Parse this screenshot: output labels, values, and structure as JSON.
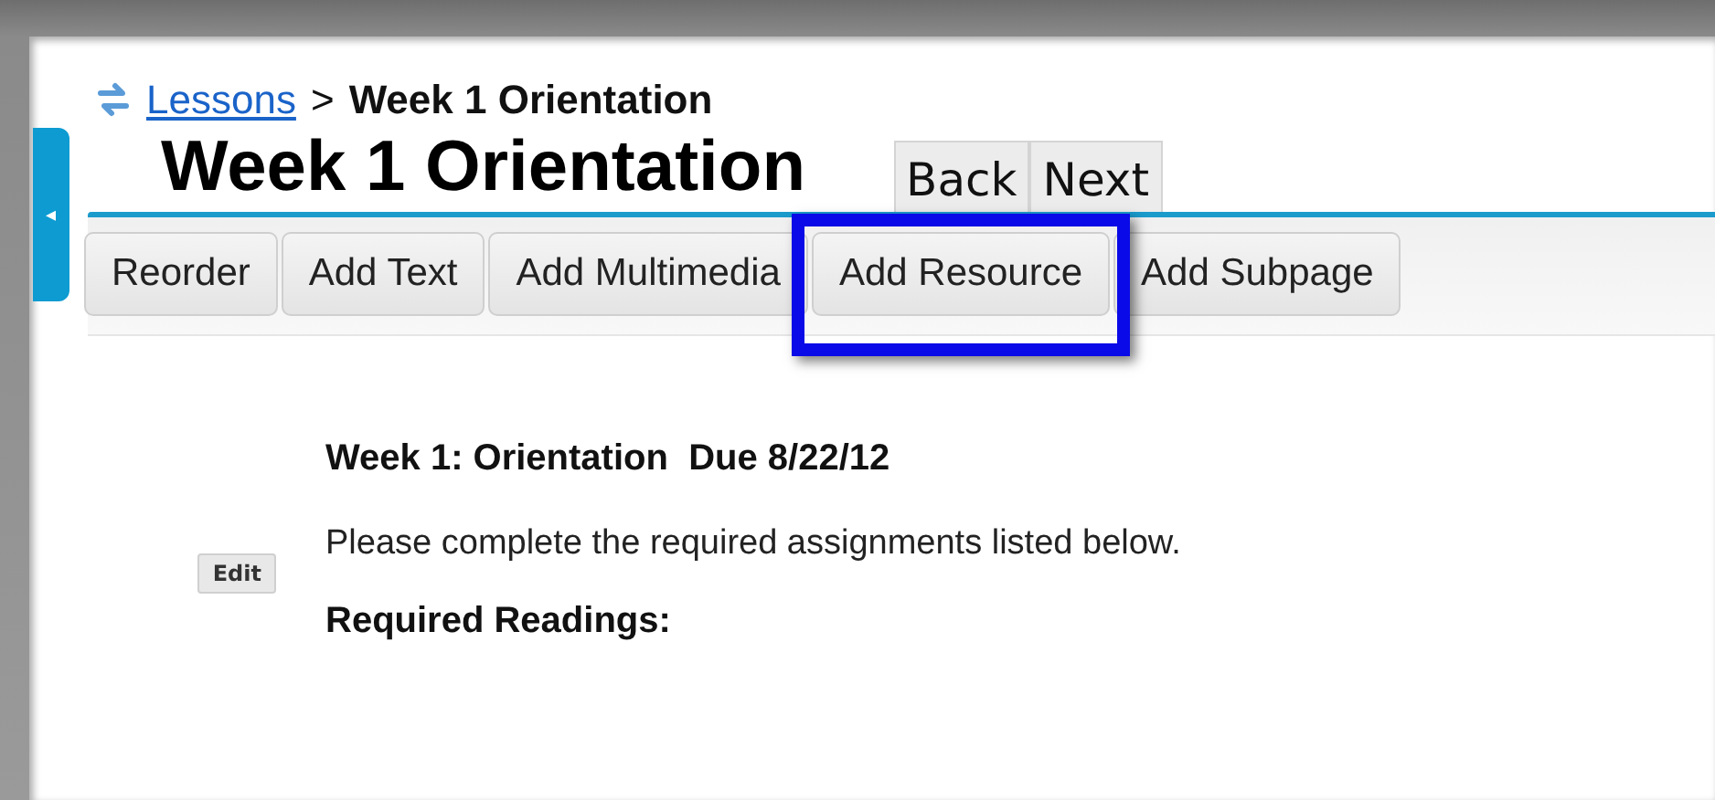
{
  "breadcrumb": {
    "link": "Lessons",
    "separator": ">",
    "current": "Week 1 Orientation"
  },
  "title": "Week 1 Orientation",
  "nav_buttons": [
    "Back",
    "Next"
  ],
  "side_tab": {
    "glyph": "◂"
  },
  "toolbar": [
    {
      "label": "Reorder",
      "highlighted": false
    },
    {
      "label": "Add Text",
      "highlighted": false
    },
    {
      "label": "Add Multimedia",
      "highlighted": false
    },
    {
      "label": "Add Resource",
      "highlighted": true
    },
    {
      "label": "Add Subpage",
      "highlighted": false
    }
  ],
  "content": {
    "edit_button": "Edit",
    "heading": "Week 1: Orientation  Due 8/22/12",
    "text": "Please complete the required assignments listed below.",
    "subheading": "Required Readings:"
  }
}
